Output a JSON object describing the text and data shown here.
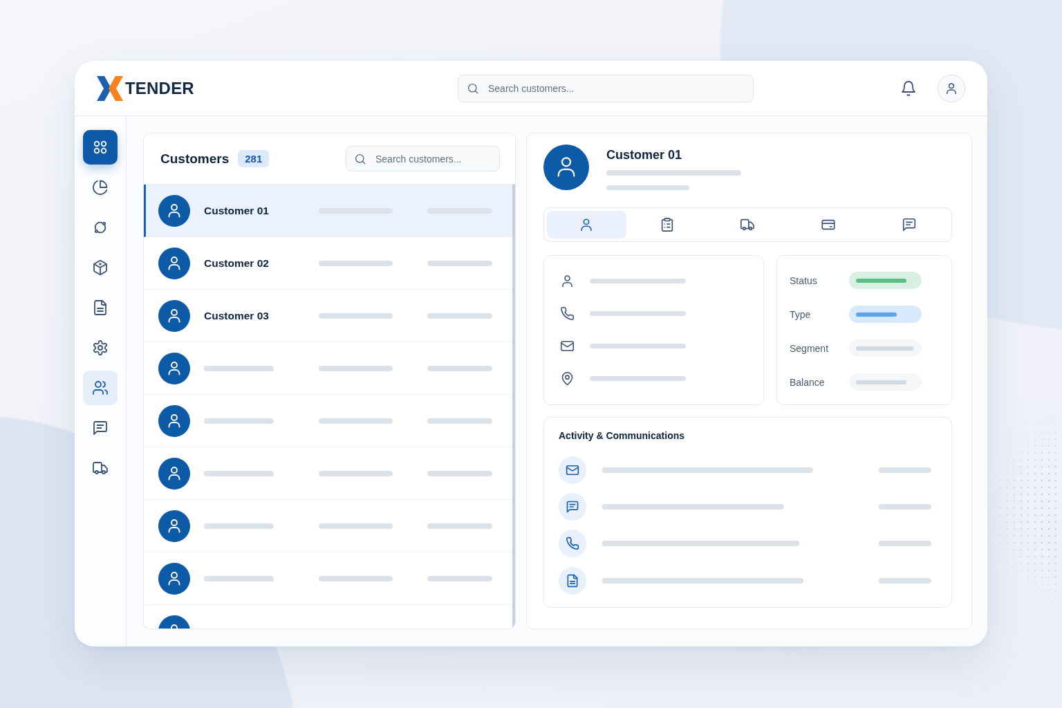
{
  "brand": {
    "logo_text": "TENDER"
  },
  "header": {
    "search": {
      "placeholder": "Search customers..."
    }
  },
  "sidebar": {
    "items": [
      {
        "kind": "primary",
        "selected": false
      },
      {
        "kind": "nav",
        "selected": false
      },
      {
        "kind": "nav",
        "selected": false
      },
      {
        "kind": "nav",
        "selected": false
      },
      {
        "kind": "nav",
        "selected": false
      },
      {
        "kind": "nav",
        "selected": false
      },
      {
        "kind": "nav",
        "selected": true
      },
      {
        "kind": "nav",
        "selected": false
      },
      {
        "kind": "nav",
        "selected": false
      }
    ]
  },
  "customers": {
    "title": "Customers",
    "count": "281",
    "search": {
      "placeholder": "Search customers..."
    },
    "rows": [
      {
        "name": "Customer 01",
        "selected": true
      },
      {
        "name": "Customer 02",
        "selected": false
      },
      {
        "name": "Customer 03",
        "selected": false
      },
      {
        "selected": false
      },
      {
        "selected": false
      },
      {
        "selected": false
      },
      {
        "selected": false
      },
      {
        "selected": false
      },
      {
        "selected": false
      }
    ]
  },
  "detail": {
    "name": "Customer 01",
    "tabs": [
      {
        "selected": true
      },
      {
        "selected": false
      },
      {
        "selected": false
      },
      {
        "selected": false
      },
      {
        "selected": false
      }
    ],
    "fields": [
      {
        "label": "Status",
        "color": "#5cbf83"
      },
      {
        "label": "Type",
        "color": "#5aa3ef"
      },
      {
        "label": "Segment",
        "color": "#d3d9e2"
      },
      {
        "label": "Balance",
        "color": "#d3d9e2"
      }
    ],
    "activity": {
      "title": "Activity & Communications"
    }
  }
}
